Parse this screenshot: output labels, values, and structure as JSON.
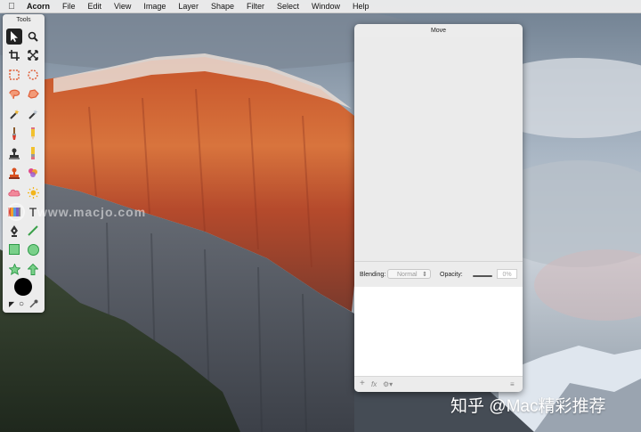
{
  "menubar": {
    "apple_icon": "apple-icon",
    "app_name": "Acorn",
    "items": [
      "File",
      "Edit",
      "View",
      "Image",
      "Layer",
      "Shape",
      "Filter",
      "Select",
      "Window",
      "Help"
    ]
  },
  "tools": {
    "title": "Tools",
    "items": [
      {
        "name": "move-tool-icon",
        "active": true
      },
      {
        "name": "zoom-tool-icon"
      },
      {
        "name": "crop-tool-icon"
      },
      {
        "name": "transform-tool-icon"
      },
      {
        "name": "rect-select-tool-icon"
      },
      {
        "name": "oval-select-tool-icon"
      },
      {
        "name": "lasso-tool-icon"
      },
      {
        "name": "polygon-lasso-tool-icon"
      },
      {
        "name": "magic-wand-tool-icon"
      },
      {
        "name": "magic-wand-alt-tool-icon"
      },
      {
        "name": "brush-tool-icon"
      },
      {
        "name": "pencil-tool-icon"
      },
      {
        "name": "stamp-tool-icon"
      },
      {
        "name": "eraser-tool-icon"
      },
      {
        "name": "clone-tool-icon"
      },
      {
        "name": "smudge-tool-icon"
      },
      {
        "name": "cloud-shape-tool-icon"
      },
      {
        "name": "sun-tool-icon"
      },
      {
        "name": "gradient-tool-icon"
      },
      {
        "name": "text-tool-icon"
      },
      {
        "name": "pen-tool-icon"
      },
      {
        "name": "line-tool-icon"
      },
      {
        "name": "rectangle-shape-tool-icon"
      },
      {
        "name": "oval-shape-tool-icon"
      },
      {
        "name": "star-shape-tool-icon"
      },
      {
        "name": "arrow-shape-tool-icon"
      }
    ],
    "text_tool_glyph": "T",
    "foreground_color": "#000000"
  },
  "layers_window": {
    "title": "Move",
    "blending_label": "Blending:",
    "blending_value": "Normal",
    "opacity_label": "Opacity:",
    "opacity_value": "0%",
    "footer_add": "+",
    "footer_fx": "fx",
    "footer_gear": "⚙▾",
    "footer_trash": "≡"
  },
  "watermarks": {
    "site": "www.macjo.com",
    "zhihu": "知乎 @Mac精彩推荐"
  }
}
